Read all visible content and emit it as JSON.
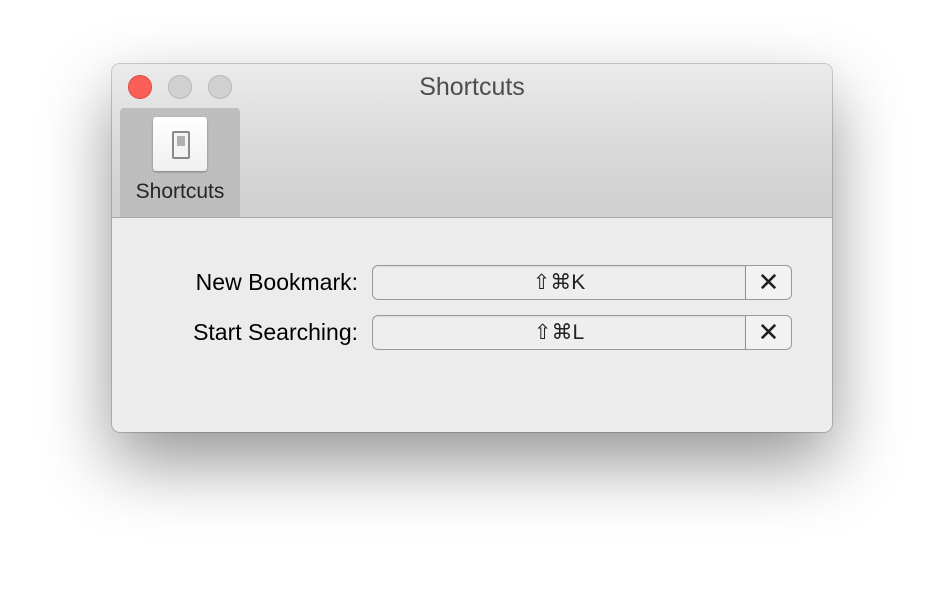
{
  "window": {
    "title": "Shortcuts"
  },
  "toolbar": {
    "items": [
      {
        "label": "Shortcuts",
        "icon": "switch-icon",
        "selected": true
      }
    ]
  },
  "shortcuts": [
    {
      "label": "New Bookmark:",
      "value": "⇧⌘K",
      "clear_symbol": "✕"
    },
    {
      "label": "Start Searching:",
      "value": "⇧⌘L",
      "clear_symbol": "✕"
    }
  ],
  "colors": {
    "close_button": "#fc5f57",
    "inactive_button": "#d0d0d0",
    "selected_toolbar_item": "#bebebe"
  }
}
